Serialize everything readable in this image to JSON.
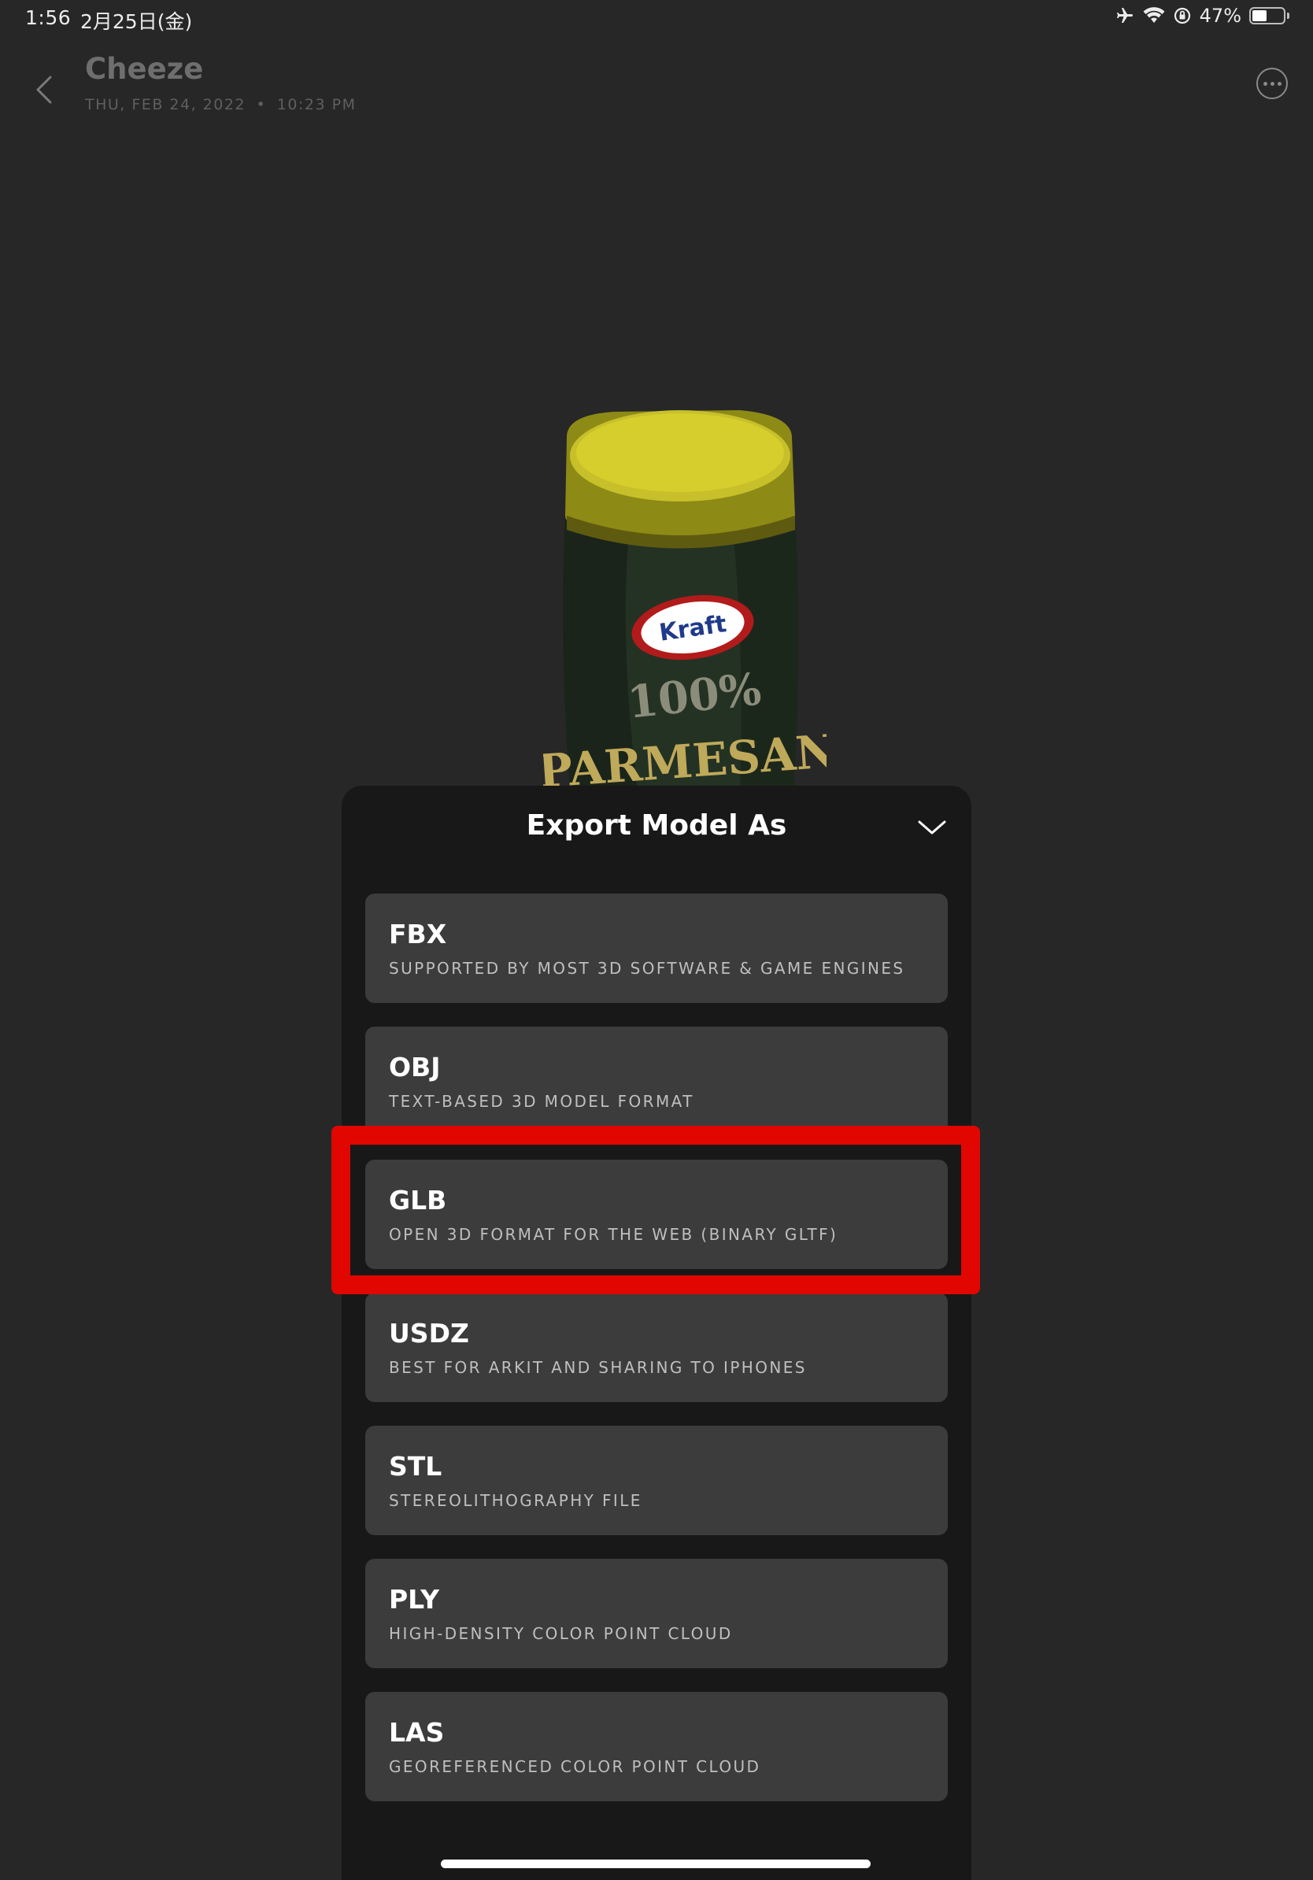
{
  "status_bar": {
    "time": "1:56",
    "date": "2月25日(金)",
    "battery_percent": "47%",
    "battery_level": 0.47,
    "icons": [
      "airplane-icon",
      "wifi-icon",
      "orientation-lock-icon",
      "battery-icon"
    ]
  },
  "header": {
    "title": "Cheeze",
    "date": "THU, FEB 24, 2022",
    "time": "10:23 PM",
    "separator": "•"
  },
  "model": {
    "brand_label": "Kraft",
    "product_text_1": "100%",
    "product_text_2": "PARMESAN"
  },
  "sheet": {
    "title": "Export Model As",
    "options": [
      {
        "format": "FBX",
        "description": "SUPPORTED BY MOST 3D SOFTWARE & GAME ENGINES"
      },
      {
        "format": "OBJ",
        "description": "TEXT-BASED 3D MODEL FORMAT"
      },
      {
        "format": "GLB",
        "description": "OPEN 3D FORMAT FOR THE WEB (BINARY GLTF)"
      },
      {
        "format": "USDZ",
        "description": "BEST FOR ARKIT AND SHARING TO IPHONES"
      },
      {
        "format": "STL",
        "description": "STEREOLITHOGRAPHY FILE"
      },
      {
        "format": "PLY",
        "description": "HIGH-DENSITY COLOR POINT CLOUD"
      },
      {
        "format": "LAS",
        "description": "GEOREFERENCED COLOR POINT CLOUD"
      }
    ],
    "highlighted_format": "GLB"
  },
  "colors": {
    "background": "#272727",
    "sheet": "#181818",
    "card": "#3c3c3d",
    "highlight": "#e10600"
  }
}
